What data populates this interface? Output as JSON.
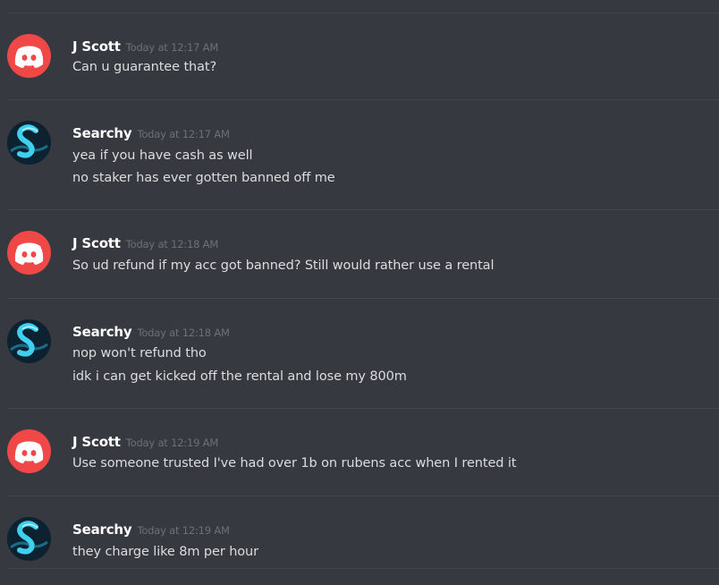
{
  "messages": [
    {
      "author": "J Scott",
      "avatar": "discord-logo-icon",
      "timestamp": "Today at 12:17 AM",
      "lines": [
        "Can u guarantee that?"
      ]
    },
    {
      "author": "Searchy",
      "avatar": "searchy-avatar-icon",
      "timestamp": "Today at 12:17 AM",
      "lines": [
        "yea if you have cash as well",
        "no staker has ever gotten banned off me"
      ]
    },
    {
      "author": "J Scott",
      "avatar": "discord-logo-icon",
      "timestamp": "Today at 12:18 AM",
      "lines": [
        "So ud refund if my acc got banned? Still would rather use a rental"
      ]
    },
    {
      "author": "Searchy",
      "avatar": "searchy-avatar-icon",
      "timestamp": "Today at 12:18 AM",
      "lines": [
        "nop won't refund tho",
        "idk i can get kicked off the rental and lose my 800m"
      ]
    },
    {
      "author": "J Scott",
      "avatar": "discord-logo-icon",
      "timestamp": "Today at 12:19 AM",
      "lines": [
        "Use someone trusted I've had over 1b on rubens acc when I rented it"
      ]
    },
    {
      "author": "Searchy",
      "avatar": "searchy-avatar-icon",
      "timestamp": "Today at 12:19 AM",
      "lines": [
        "they charge like 8m per hour"
      ]
    }
  ],
  "colors": {
    "background": "#36393f",
    "divider": "#42464d",
    "username": "#ffffff",
    "timestamp": "#6d7177",
    "message_text": "#dcddde",
    "discord_avatar": "#f04747",
    "searchy_avatar_accent": "#3fd0f0"
  }
}
